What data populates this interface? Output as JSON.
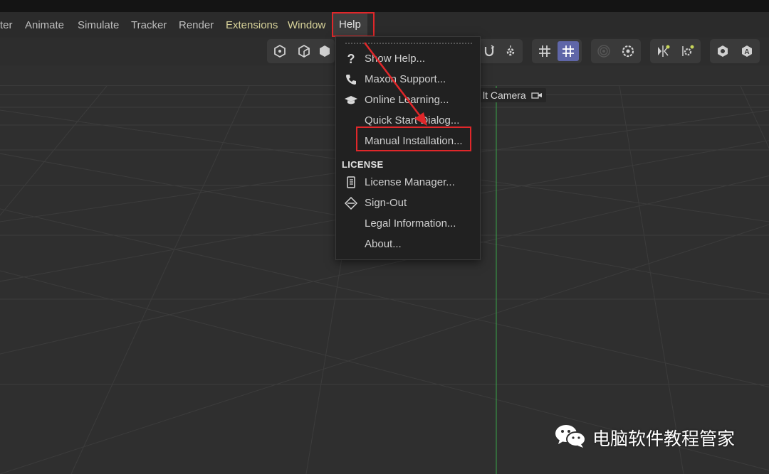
{
  "menubar": {
    "items": [
      {
        "label": "ter"
      },
      {
        "label": "Animate"
      },
      {
        "label": "Simulate"
      },
      {
        "label": "Tracker"
      },
      {
        "label": "Render"
      },
      {
        "label": "Extensions"
      },
      {
        "label": "Window"
      },
      {
        "label": "Help"
      }
    ],
    "highlight_color": "#e0272a",
    "accent_yellow": "#d8d39a"
  },
  "toolbar": {
    "icons": [
      "hex-cube-icon",
      "hex-cube-alt-icon",
      "cube-icon",
      "magnet-rotate-icon",
      "gear-snap-icon",
      "grid-icon",
      "grid-snap-icon",
      "radial-icon",
      "settings-icon",
      "symmetry-icon",
      "dot-gear-icon",
      "eye-icon",
      "a-letter-icon"
    ],
    "active_color": "#5f66a8"
  },
  "viewport": {
    "camera_label": "lt Camera",
    "axis_color": "#39a54a"
  },
  "help_menu": {
    "items": [
      {
        "label": "Show Help...",
        "icon": "question-icon"
      },
      {
        "label": "Maxon Support...",
        "icon": "phone-icon"
      },
      {
        "label": "Online Learning...",
        "icon": "graduation-cap-icon"
      },
      {
        "label": "Quick Start Dialog...",
        "icon": ""
      },
      {
        "label": "Manual Installation...",
        "icon": ""
      }
    ],
    "section_label": "LICENSE",
    "license_items": [
      {
        "label": "License Manager...",
        "icon": "document-icon"
      },
      {
        "label": "Sign-Out",
        "icon": "sign-out-icon"
      },
      {
        "label": "Legal Information...",
        "icon": ""
      },
      {
        "label": "About...",
        "icon": ""
      }
    ]
  },
  "watermark": {
    "text": "电脑软件教程管家",
    "icon": "wechat-icon"
  }
}
